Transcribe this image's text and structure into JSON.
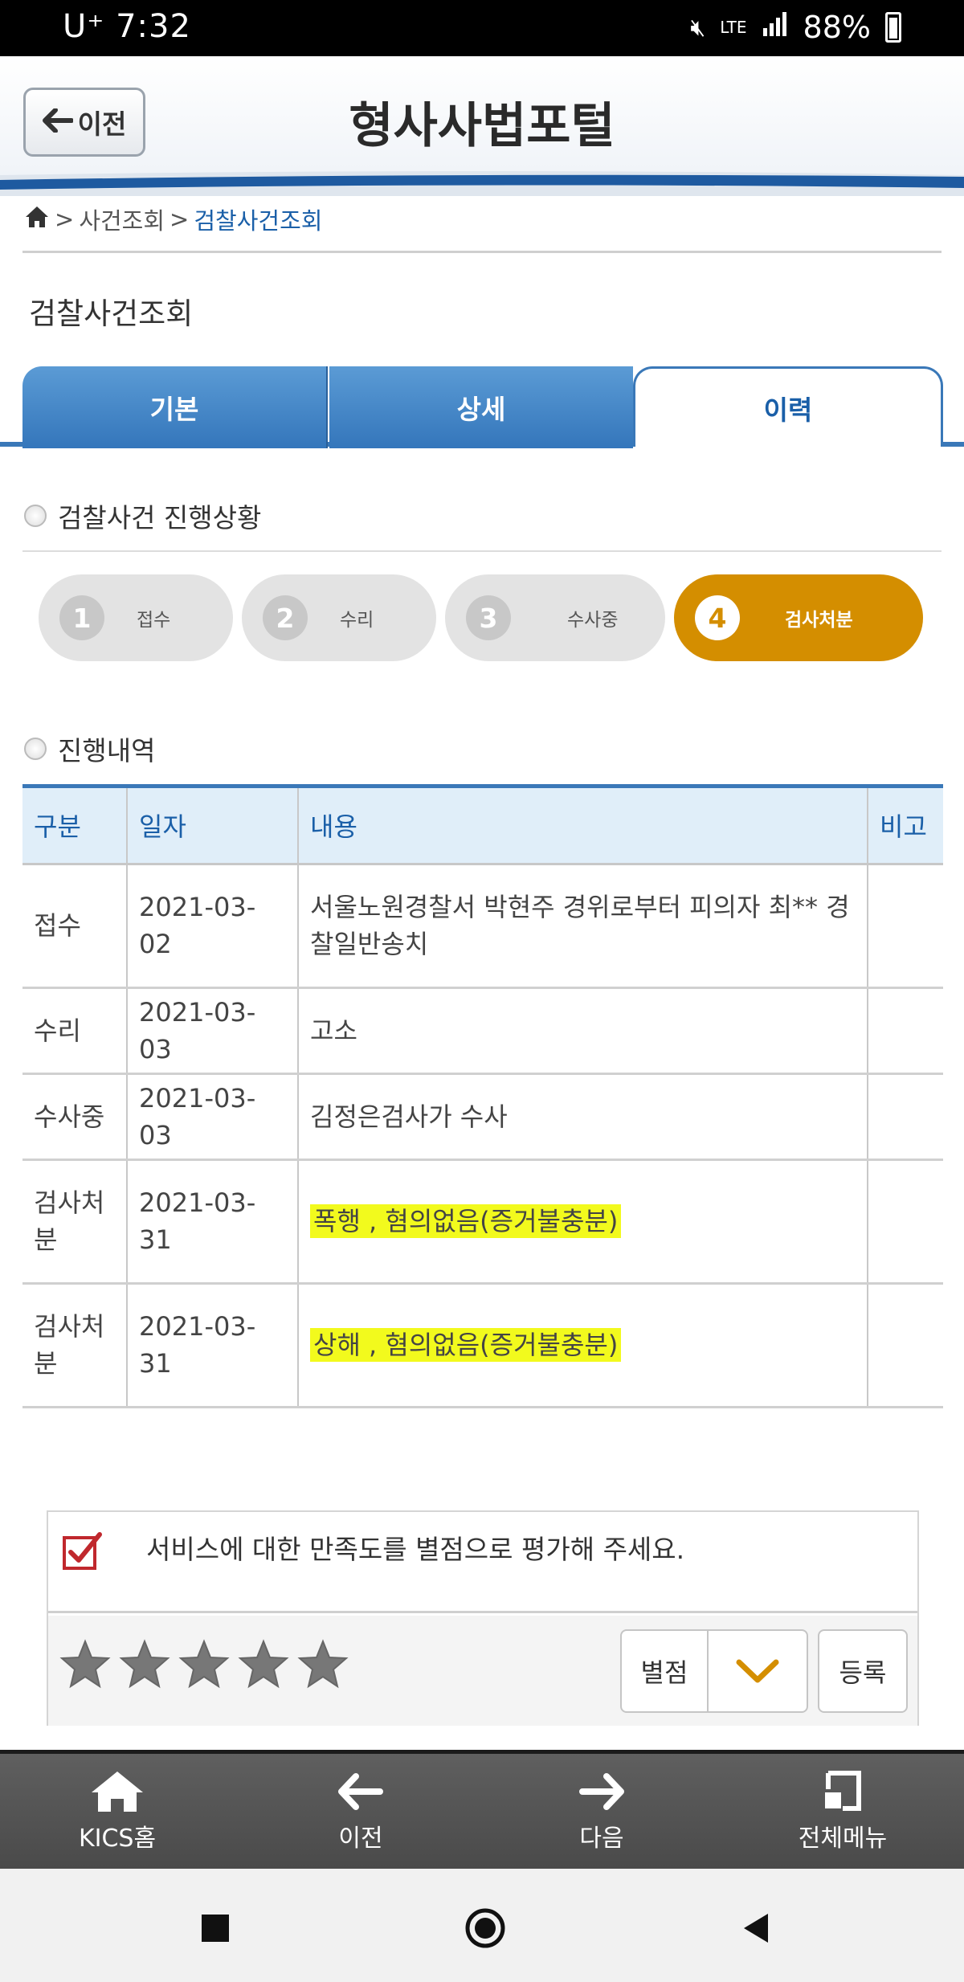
{
  "status_bar": {
    "carrier_time": "U⁺ 7:32",
    "network": "LTE",
    "battery": "88%",
    "battery_level": 0.88
  },
  "header": {
    "back_label": "이전",
    "title": "형사사법포털"
  },
  "breadcrumb": {
    "sep1": ">",
    "item1": "사건조회",
    "sep2": ">",
    "current": "검찰사건조회"
  },
  "page_title": "검찰사건조회",
  "tabs": [
    {
      "label": "기본",
      "active": false
    },
    {
      "label": "상세",
      "active": false
    },
    {
      "label": "이력",
      "active": true
    }
  ],
  "progress": {
    "title": "검찰사건 진행상황",
    "steps": [
      {
        "num": "1",
        "label": "접수",
        "active": false
      },
      {
        "num": "2",
        "label": "수리",
        "active": false
      },
      {
        "num": "3",
        "label": "수사중",
        "active": false
      },
      {
        "num": "4",
        "label": "검사처분",
        "active": true
      }
    ]
  },
  "history": {
    "title": "진행내역",
    "columns": [
      "구분",
      "일자",
      "내용",
      "비고"
    ],
    "rows": [
      {
        "type": "접수",
        "date": "2021-03-02",
        "content": "서울노원경찰서 박현주 경위로부터 피의자 최** 경찰일반송치",
        "note": "",
        "highlight": false
      },
      {
        "type": "수리",
        "date": "2021-03-03",
        "content": "고소",
        "note": "",
        "highlight": false
      },
      {
        "type": "수사중",
        "date": "2021-03-03",
        "content": "김정은검사가 수사",
        "note": "",
        "highlight": false
      },
      {
        "type": "검사처분",
        "date": "2021-03-31",
        "content": "폭행 , 혐의없음(증거불충분)",
        "note": "",
        "highlight": true
      },
      {
        "type": "검사처분",
        "date": "2021-03-31",
        "content": "상해 , 혐의없음(증거불충분)",
        "note": "",
        "highlight": true
      }
    ]
  },
  "rating": {
    "prompt": "서비스에 대한 만족도를 별점으로 평가해 주세요.",
    "stars_total": 5,
    "stars_filled": 0,
    "select_label": "별점",
    "register_label": "등록"
  },
  "bottom_nav": [
    {
      "label": "KICS홈",
      "icon": "home-icon"
    },
    {
      "label": "이전",
      "icon": "arrow-left-icon"
    },
    {
      "label": "다음",
      "icon": "arrow-right-icon"
    },
    {
      "label": "전체메뉴",
      "icon": "full-menu-icon"
    }
  ],
  "colors": {
    "primary_blue": "#3a78b8",
    "active_step": "#d48e00",
    "highlight": "#f2fa1d"
  }
}
